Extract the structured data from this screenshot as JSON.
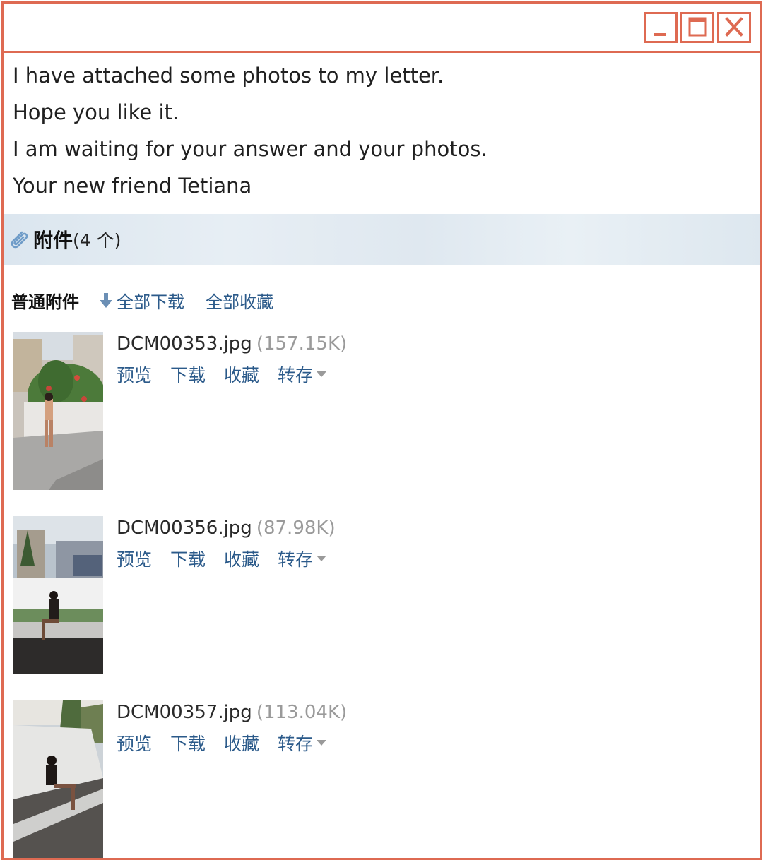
{
  "window": {
    "controls": [
      {
        "name": "minimize-icon"
      },
      {
        "name": "maximize-icon"
      },
      {
        "name": "close-icon"
      }
    ],
    "accent_color": "#de6a52"
  },
  "message": {
    "lines": [
      "I have attached some photos to my letter.",
      "Hope you like it.",
      "I am waiting for your answer and your photos.",
      "Your new friend Tetiana"
    ]
  },
  "attachments": {
    "header_title": "附件",
    "header_count": "(4 个)",
    "toolbar": {
      "label": "普通附件",
      "download_all": "全部下载",
      "save_all": "全部收藏"
    },
    "items": [
      {
        "filename": "DCM00353.jpg",
        "size": "(157.15K)",
        "actions": {
          "preview": "预览",
          "download": "下载",
          "favorite": "收藏",
          "transfer": "转存"
        }
      },
      {
        "filename": "DCM00356.jpg",
        "size": "(87.98K)",
        "actions": {
          "preview": "预览",
          "download": "下载",
          "favorite": "收藏",
          "transfer": "转存"
        }
      },
      {
        "filename": "DCM00357.jpg",
        "size": "(113.04K)",
        "actions": {
          "preview": "预览",
          "download": "下载",
          "favorite": "收藏",
          "transfer": "转存"
        }
      }
    ]
  },
  "colors": {
    "link": "#2b5a8a",
    "size_text": "#9a9a9a",
    "header_bg": "#e2eaf1"
  }
}
